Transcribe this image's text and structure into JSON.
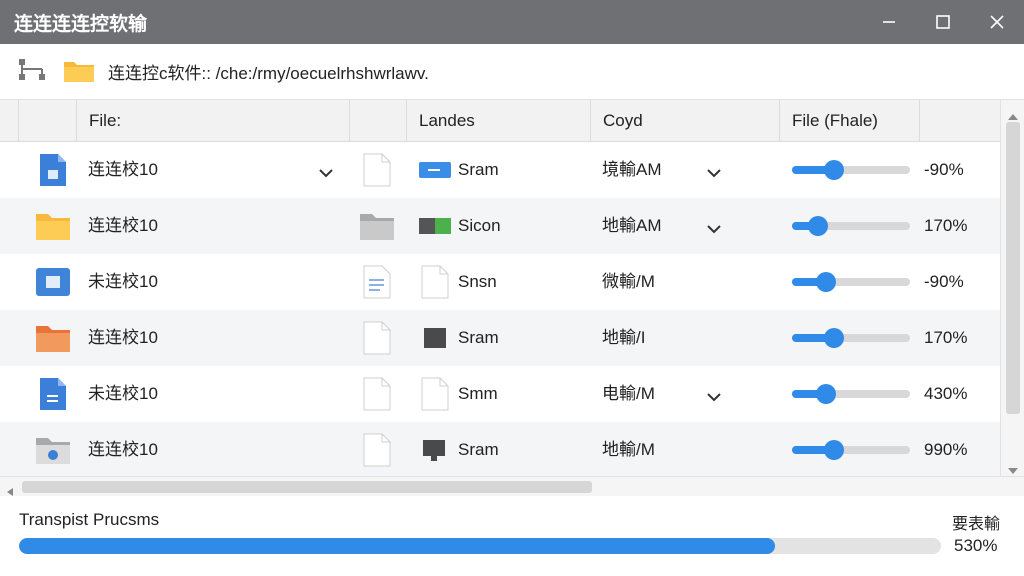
{
  "window": {
    "title": "连连连连控软输",
    "controls": [
      "minimize-icon",
      "maximize-icon",
      "close-icon"
    ]
  },
  "pathbar": {
    "path": "连连控c软件:: /che:/rmy/oecuelrhshwrlawv."
  },
  "table": {
    "columns": [
      {
        "label": ""
      },
      {
        "label": "File:"
      },
      {
        "label": ""
      },
      {
        "label": "Landes"
      },
      {
        "label": "Coyd"
      },
      {
        "label": "File (Fhale)"
      }
    ],
    "rows": [
      {
        "icon": "doc-blue-icon",
        "name": "连连校10",
        "dropdown": true,
        "sub_icon": "blank-doc-icon",
        "land_icon": "blue-chip-icon",
        "land": "Sram",
        "code": "境輸AM",
        "code_dropdown": true,
        "pct": 0.36,
        "pct_text": "-90%"
      },
      {
        "icon": "folder-yellow-icon",
        "name": "连连校10",
        "dropdown": false,
        "sub_icon": "folder-gray-icon",
        "land_icon": "dual-chip-icon",
        "land": "Sicon",
        "code": "地輸AM",
        "code_dropdown": true,
        "pct": 0.22,
        "pct_text": "170%"
      },
      {
        "icon": "doc-box-icon",
        "name": "未连校10",
        "dropdown": false,
        "sub_icon": "lines-doc-icon",
        "land_icon": "blank-doc-icon",
        "land": "Snsn",
        "code": "微輸/M",
        "code_dropdown": false,
        "pct": 0.29,
        "pct_text": "-90%"
      },
      {
        "icon": "folder-orange-icon",
        "name": "连连校10",
        "dropdown": false,
        "sub_icon": "blank-doc-icon",
        "land_icon": "gray-square-icon",
        "land": "Sram",
        "code": "地輸/I",
        "code_dropdown": false,
        "pct": 0.36,
        "pct_text": "170%"
      },
      {
        "icon": "doc-blue-s-icon",
        "name": "未连校10",
        "dropdown": false,
        "sub_icon": "blank-doc-icon",
        "land_icon": "blank-doc-icon",
        "land": "Smm",
        "code": "电輸/M",
        "code_dropdown": true,
        "pct": 0.29,
        "pct_text": "430%"
      },
      {
        "icon": "folder-gray-icon",
        "name": "连连校10",
        "dropdown": false,
        "sub_icon": "blank-doc-icon",
        "land_icon": "monitor-icon",
        "land": "Sram",
        "code": "地輸/M",
        "code_dropdown": false,
        "pct": 0.36,
        "pct_text": "990%"
      }
    ]
  },
  "footer": {
    "label": "Transpist Prucsms",
    "right_label": "要表輸",
    "progress": 0.82,
    "progress_text": "530%"
  },
  "colors": {
    "titlebar": "#6f7074",
    "accent": "#2f8ae8"
  }
}
